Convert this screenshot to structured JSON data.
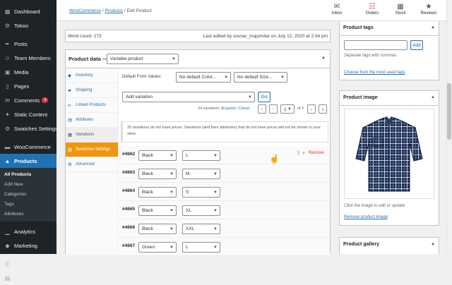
{
  "sidebar": {
    "top": [
      {
        "label": "Dashboard",
        "icon": "dashboard-icon",
        "glyph": "▦"
      },
      {
        "label": "Tokoo",
        "icon": "tokoo-icon",
        "glyph": "⚙"
      }
    ],
    "mid": [
      {
        "label": "Posts",
        "icon": "pin-icon",
        "glyph": "✒"
      },
      {
        "label": "Team Members",
        "icon": "team-icon",
        "glyph": "☺"
      },
      {
        "label": "Media",
        "icon": "media-icon",
        "glyph": "▣"
      },
      {
        "label": "Pages",
        "icon": "pages-icon",
        "glyph": "▯"
      },
      {
        "label": "Comments",
        "icon": "comments-icon",
        "glyph": "✉",
        "badge": "4"
      },
      {
        "label": "Static Content",
        "icon": "static-content-icon",
        "glyph": "✦"
      },
      {
        "label": "Swatches Settings",
        "icon": "swatches-icon",
        "glyph": "⚙"
      }
    ],
    "woo": [
      {
        "label": "WooCommerce",
        "icon": "woocommerce-icon",
        "glyph": "▬"
      }
    ],
    "products_label": "Products",
    "sub": [
      "All Products",
      "Add New",
      "Categories",
      "Tags",
      "Attributes"
    ],
    "bottom": [
      {
        "label": "Analytics",
        "icon": "analytics-icon",
        "glyph": "▁"
      },
      {
        "label": "Marketing",
        "icon": "marketing-icon",
        "glyph": "◆"
      }
    ],
    "last": [
      {
        "label": "Elementor",
        "icon": "elementor-icon",
        "glyph": "Ⓔ"
      },
      {
        "label": "Templates",
        "icon": "templates-icon",
        "glyph": "▤"
      }
    ]
  },
  "topbar": {
    "crumb_woo": "WooCommerce",
    "crumb_products": "Products",
    "crumb_current": "Edit Product",
    "sep": "/",
    "actions": [
      {
        "label": "Inbox",
        "icon": "inbox-icon",
        "glyph": "✉"
      },
      {
        "label": "Orders",
        "icon": "orders-icon",
        "glyph": "☷"
      },
      {
        "label": "Stock",
        "icon": "stock-icon",
        "glyph": "▦"
      },
      {
        "label": "Reviews",
        "icon": "reviews-icon",
        "glyph": "★"
      }
    ]
  },
  "editor": {
    "word_count": "Word count: 273",
    "last_edited": "Last edited by sourav_majumdar on July 12, 2020 at 2:34 pm"
  },
  "product_data": {
    "title": "Product data —",
    "type": "Variable product",
    "tabs": [
      {
        "label": "Inventory",
        "icon": "inventory-icon",
        "glyph": "◆"
      },
      {
        "label": "Shipping",
        "icon": "shipping-icon",
        "glyph": "▰"
      },
      {
        "label": "Linked Products",
        "icon": "link-icon",
        "glyph": "∞"
      },
      {
        "label": "Attributes",
        "icon": "attributes-icon",
        "glyph": "▤"
      },
      {
        "label": "Variations",
        "icon": "variations-icon",
        "glyph": "▦"
      },
      {
        "label": "Swatches Settings",
        "icon": "swatches-tab-icon",
        "glyph": "▧"
      },
      {
        "label": "Advanced",
        "icon": "advanced-icon",
        "glyph": "⚙"
      }
    ],
    "default_form_label": "Default Form Values:",
    "default_color": "No default Color...",
    "default_size": "No default Size...",
    "add_variation": "Add variation",
    "go": "Go",
    "count_text": "24 variations (",
    "expand": "Expand",
    "slash": " / ",
    "close": "Close",
    "count_end": ")",
    "page": "1",
    "of": "of 2",
    "pager_first": "«",
    "pager_prev": "‹",
    "pager_next": "›",
    "pager_last": "»",
    "notice": "25 variations do not have prices. Variations (and their attributes) that do not have prices will not be shown in your store.",
    "remove": "Remove",
    "variations": [
      {
        "id": "#4662",
        "color": "Black",
        "size": "L"
      },
      {
        "id": "#4663",
        "color": "Black",
        "size": "M"
      },
      {
        "id": "#4664",
        "color": "Black",
        "size": "S"
      },
      {
        "id": "#4665",
        "color": "Black",
        "size": "XL"
      },
      {
        "id": "#4666",
        "color": "Black",
        "size": "XXL"
      },
      {
        "id": "#4667",
        "color": "Green",
        "size": "L"
      }
    ]
  },
  "right": {
    "tags_title": "Product tags",
    "tag_input": "",
    "add": "Add",
    "tag_hint": "Separate tags with commas",
    "tag_choose": "Choose from the most used tags",
    "image_title": "Product image",
    "image_hint": "Click the image to edit or update",
    "image_remove": "Remove product image",
    "gallery_title": "Product gallery"
  },
  "colors": {
    "accent": "#2271b1",
    "sidebar": "#1d2327",
    "active": "#2271b1",
    "orange": "#f0950e",
    "remove": "#d63638"
  }
}
